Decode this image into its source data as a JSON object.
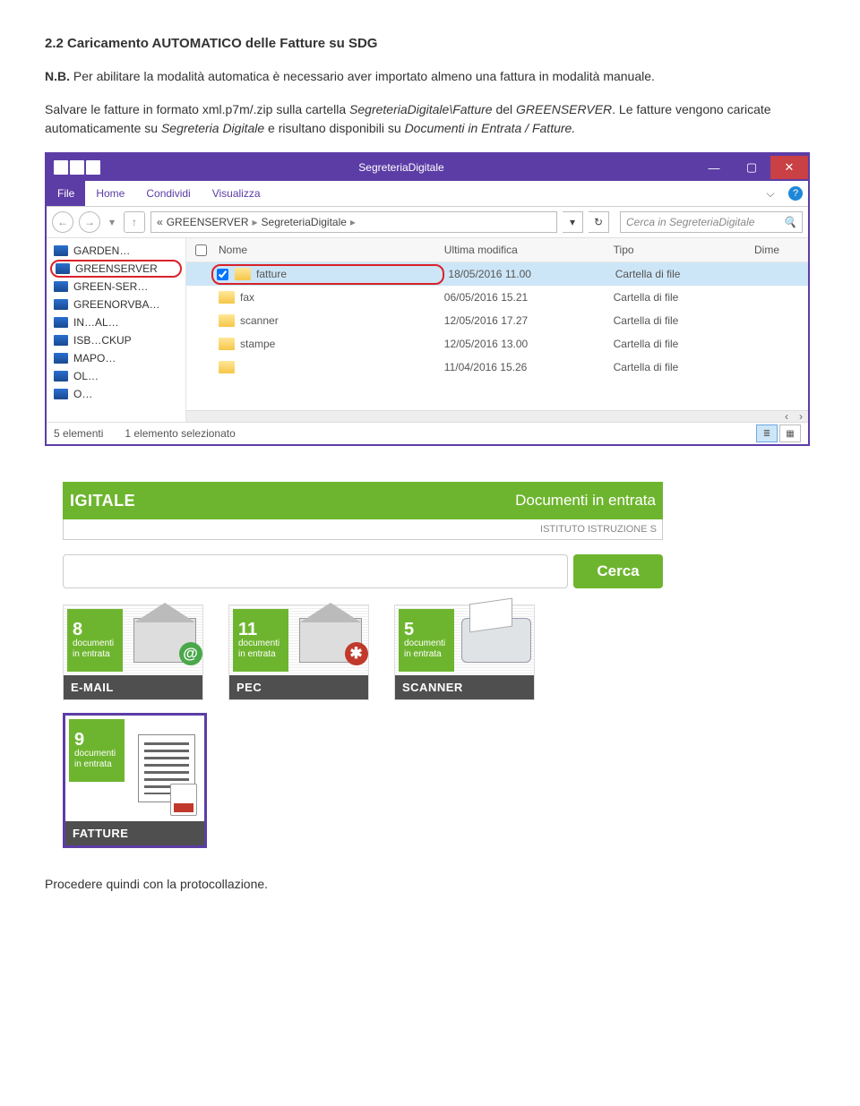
{
  "title": "2.2 Caricamento AUTOMATICO delle Fatture su SDG",
  "para1_prefix": "N.B.",
  "para1_rest": " Per abilitare la modalità automatica è necessario aver importato almeno una fattura in modalità manuale.",
  "para2_a": "Salvare le fatture in formato xml.p7m/.zip sulla cartella ",
  "para2_em1": "SegreteriaDigitale\\Fatture",
  "para2_b": " del ",
  "para2_em2": "GREENSERVER",
  "para2_c": ". Le fatture vengono caricate automaticamente su ",
  "para2_em3": "Segreteria Digitale",
  "para2_d": " e risultano disponibili su ",
  "para2_em4": "Documenti in Entrata / Fatture.",
  "explorer": {
    "title": "SegreteriaDigitale",
    "ribbon": {
      "file": "File",
      "tabs": [
        "Home",
        "Condividi",
        "Visualizza"
      ]
    },
    "address": {
      "crumbs": [
        "GREENSERVER",
        "SegreteriaDigitale"
      ],
      "search_placeholder": "Cerca in SegreteriaDigitale"
    },
    "sidebar": [
      "GARDEN…",
      "GREENSERVER",
      "GREEN-SER…",
      "GREENORVBA…",
      "IN…AL…",
      "ISB…CKUP",
      "MAPO…",
      "OL…",
      "O…"
    ],
    "columns": [
      "Nome",
      "Ultima modifica",
      "Tipo",
      "Dime"
    ],
    "rows": [
      {
        "name": "fatture",
        "mod": "18/05/2016 11.00",
        "type": "Cartella di file",
        "selected": true
      },
      {
        "name": "fax",
        "mod": "06/05/2016 15.21",
        "type": "Cartella di file"
      },
      {
        "name": "scanner",
        "mod": "12/05/2016 17.27",
        "type": "Cartella di file"
      },
      {
        "name": "stampe",
        "mod": "12/05/2016 13.00",
        "type": "Cartella di file"
      },
      {
        "name": "",
        "mod": "11/04/2016 15.26",
        "type": "Cartella di file"
      }
    ],
    "status": {
      "count": "5 elementi",
      "selected": "1 elemento selezionato"
    }
  },
  "webapp": {
    "logo": "IGITALE",
    "tab_active": "Documenti in entrata",
    "sublabel": "ISTITUTO ISTRUZIONE S",
    "search_btn": "Cerca",
    "cards": [
      {
        "num": "8",
        "txt": "documenti in entrata",
        "label": "E-MAIL"
      },
      {
        "num": "11",
        "txt": "documenti in entrata",
        "label": "PEC"
      },
      {
        "num": "5",
        "txt": "documenti in entrata",
        "label": "SCANNER"
      }
    ],
    "fatture": {
      "num": "9",
      "txt": "documenti in entrata",
      "label": "FATTURE"
    }
  },
  "bottom": "Procedere quindi con la protocollazione."
}
